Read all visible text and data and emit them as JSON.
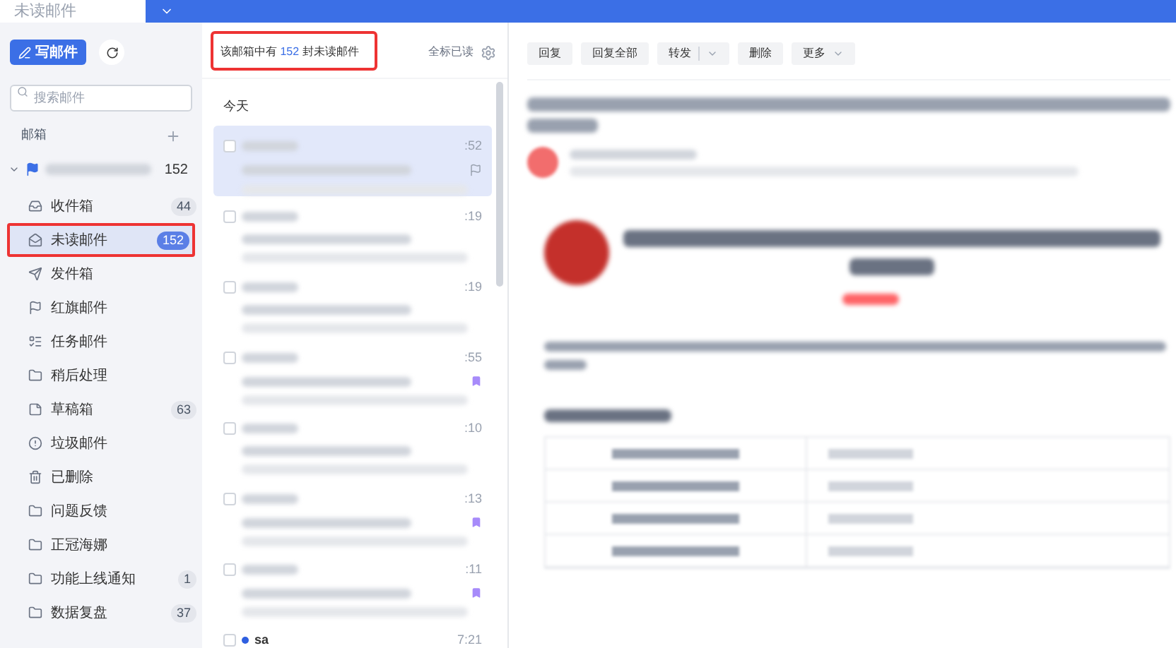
{
  "tab": {
    "label": "未读邮件"
  },
  "compose_button": "写邮件",
  "search": {
    "placeholder": "搜索邮件"
  },
  "mailbox_heading": "邮箱",
  "account": {
    "count": "152",
    "expanded": true
  },
  "folders": [
    {
      "kind": "inbox",
      "label": "收件箱",
      "count": "44",
      "selected": false,
      "annotated": false
    },
    {
      "kind": "unread",
      "label": "未读邮件",
      "count": "152",
      "selected": true,
      "annotated": true
    },
    {
      "kind": "send",
      "label": "发件箱",
      "selected": false,
      "annotated": false
    },
    {
      "kind": "flag",
      "label": "红旗邮件",
      "selected": false,
      "annotated": false
    },
    {
      "kind": "task",
      "label": "任务邮件",
      "selected": false,
      "annotated": false
    },
    {
      "kind": "folder",
      "label": "稍后处理",
      "selected": false,
      "annotated": false
    },
    {
      "kind": "draft",
      "label": "草稿箱",
      "count": "63",
      "selected": false,
      "annotated": false
    },
    {
      "kind": "spam",
      "label": "垃圾邮件",
      "selected": false,
      "annotated": false
    },
    {
      "kind": "trash",
      "label": "已删除",
      "selected": false,
      "annotated": false
    },
    {
      "kind": "folder",
      "label": "问题反馈",
      "selected": false,
      "annotated": false
    },
    {
      "kind": "folder",
      "label": "正冠海娜",
      "selected": false,
      "annotated": false
    },
    {
      "kind": "folder",
      "label": "功能上线通知",
      "count": "1",
      "selected": false,
      "annotated": false
    },
    {
      "kind": "folder",
      "label": "数据复盘",
      "count": "37",
      "selected": false,
      "annotated": false
    }
  ],
  "list_header": {
    "prefix": "该邮箱中有",
    "count": "152",
    "suffix": "封未读邮件",
    "annotated": true
  },
  "mark_all_read": "全标已读",
  "date_group": "今天",
  "messages": [
    {
      "time": ":52",
      "selected": true,
      "kind": "flag"
    },
    {
      "time": ":19",
      "selected": false,
      "kind": "plain"
    },
    {
      "time": ":19",
      "selected": false,
      "kind": "plain"
    },
    {
      "time": ":55",
      "selected": false,
      "kind": "tag"
    },
    {
      "time": ":10",
      "selected": false,
      "kind": "plain"
    },
    {
      "time": ":13",
      "selected": false,
      "kind": "tag"
    },
    {
      "time": ":11",
      "selected": false,
      "kind": "tag"
    },
    {
      "time": "7:21",
      "selected": false,
      "kind": "plain",
      "sender": "sa"
    }
  ],
  "toolbar": [
    {
      "label": "回复",
      "kind": "plain"
    },
    {
      "label": "回复全部",
      "kind": "plain"
    },
    {
      "label": "转发",
      "kind": "split"
    },
    {
      "label": "删除",
      "kind": "plain"
    },
    {
      "label": "更多",
      "kind": "dropdown"
    }
  ]
}
